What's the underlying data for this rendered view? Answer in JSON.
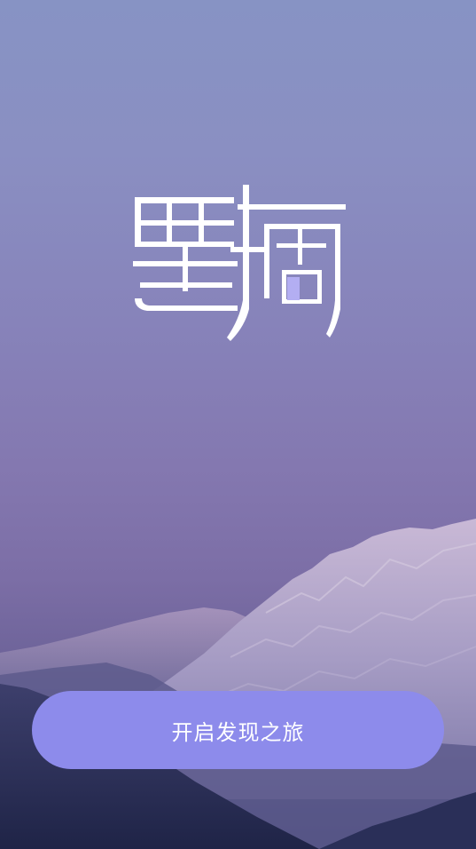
{
  "app": {
    "logo_text": "墨摘"
  },
  "actions": {
    "start_label": "开启发现之旅"
  },
  "colors": {
    "sky_top": "#8793c4",
    "sky_mid": "#8478b0",
    "button": "#8d8beb",
    "logo": "#ffffff",
    "logo_accent": "#b3aef2"
  }
}
